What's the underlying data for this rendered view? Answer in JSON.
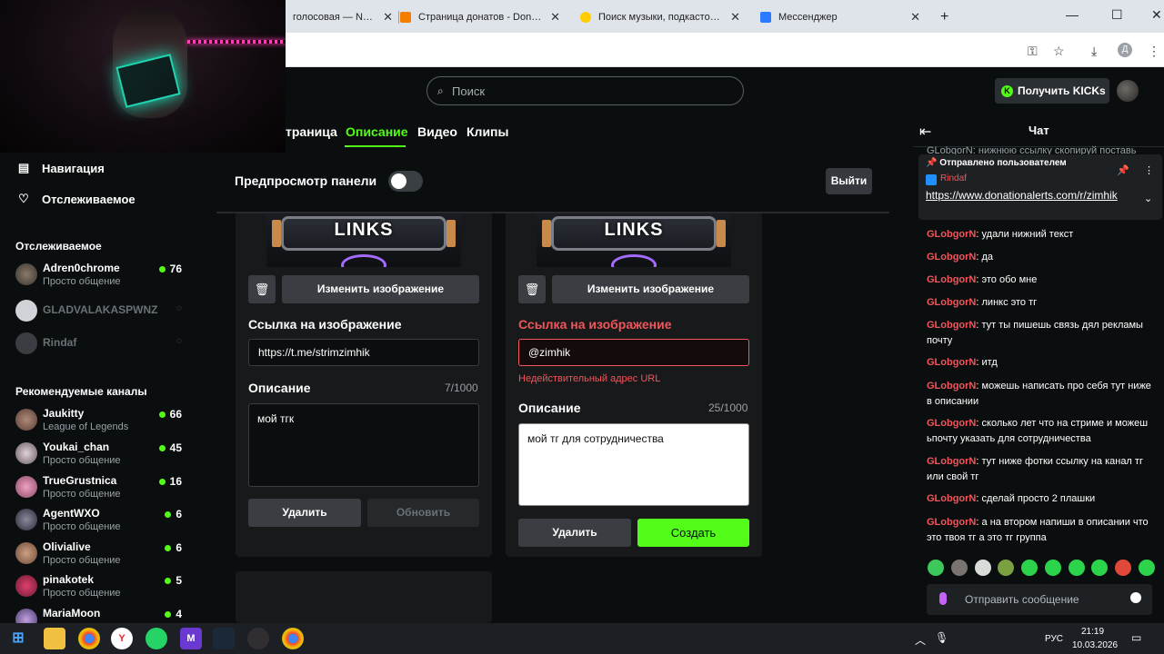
{
  "browser": {
    "tabs": [
      {
        "label": "голосовая — Nekt"
      },
      {
        "label": "Страница донатов - DonationA"
      },
      {
        "label": "Поиск музыки, подкастов и ау"
      },
      {
        "label": "Мессенджер"
      }
    ],
    "new_tab": "+",
    "profile_letter": "Д"
  },
  "header": {
    "search_placeholder": "Поиск",
    "kicks_button": "Получить KICKs"
  },
  "nav": {
    "main": [
      {
        "label": "Навигация"
      },
      {
        "label": "Отслеживаемое"
      }
    ],
    "following_heading": "Отслеживаемое",
    "following": [
      {
        "name": "Adren0chrome",
        "category": "Просто общение",
        "viewers": "76"
      },
      {
        "name": "GLADVALAKASPWNZ"
      },
      {
        "name": "Rindaf"
      }
    ],
    "recommended_heading": "Рекомендуемые каналы",
    "recommended": [
      {
        "name": "Jaukitty",
        "category": "League of Legends",
        "viewers": "66"
      },
      {
        "name": "Youkai_chan",
        "category": "Просто общение",
        "viewers": "45"
      },
      {
        "name": "TrueGrustnica",
        "category": "Просто общение",
        "viewers": "16"
      },
      {
        "name": "AgentWXO",
        "category": "Просто общение",
        "viewers": "6"
      },
      {
        "name": "Olivialive",
        "category": "Просто общение",
        "viewers": "6"
      },
      {
        "name": "pinakotek",
        "category": "Просто общение",
        "viewers": "5"
      },
      {
        "name": "MariaMoon",
        "viewers": "4"
      }
    ]
  },
  "settings": {
    "tabs": [
      {
        "label": "траница"
      },
      {
        "label": "Описание"
      },
      {
        "label": "Видео"
      },
      {
        "label": "Клипы"
      }
    ],
    "preview_label": "Предпросмотр панели",
    "exit_button": "Выйти",
    "panel_left": {
      "image_text": "LINKS",
      "change_image": "Изменить изображение",
      "link_label": "Ссылка на изображение",
      "link_value": "https://t.me/strimzimhik",
      "desc_label": "Описание",
      "desc_counter": "7/1000",
      "desc_value": "мой тгк",
      "delete_button": "Удалить",
      "update_button": "Обновить"
    },
    "panel_right": {
      "image_text": "LINKS",
      "change_image": "Изменить изображение",
      "link_label": "Ссылка на изображение",
      "link_value": "@zimhik",
      "link_error": "Недействительный адрес URL",
      "desc_label": "Описание",
      "desc_counter": "25/1000",
      "desc_value": "мой тг для сотрудничества",
      "delete_button": "Удалить",
      "create_button": "Создать"
    }
  },
  "chat": {
    "title": "Чат",
    "cut_message": "GLobgorN: нижнюю ссылку скопируй поставь",
    "pinned": {
      "header": "Отправлено пользователем",
      "user": "Rindaf",
      "link": "https://www.donationalerts.com/r/zimhik"
    },
    "messages": [
      {
        "user": "GLobgorN",
        "text": "удали нижний текст"
      },
      {
        "user": "GLobgorN",
        "text": "да"
      },
      {
        "user": "GLobgorN",
        "text": "это обо мне"
      },
      {
        "user": "GLobgorN",
        "text": "линкс это тг"
      },
      {
        "user": "GLobgorN",
        "text": "тут ты пишешь связь дял рекламы почту"
      },
      {
        "user": "GLobgorN",
        "text": "итд"
      },
      {
        "user": "GLobgorN",
        "text": "можешь написать про себя тут ниже в описании"
      },
      {
        "user": "GLobgorN",
        "text": "сколько лет что на стриме и можеш ьпочту указать для сотрудничества"
      },
      {
        "user": "GLobgorN",
        "text": "тут ниже фотки ссылку на канал тг или свой тг"
      },
      {
        "user": "GLobgorN",
        "text": "сделай просто 2 плашки"
      },
      {
        "user": "GLobgorN",
        "text": "а на втором напиши в описании что это твоя тг а это тг группа"
      }
    ],
    "input_placeholder": "Отправить сообщение"
  },
  "taskbar": {
    "time": "21:19",
    "date": "10.03.2026",
    "lang": "РУС"
  },
  "colors": {
    "kick_green": "#53fc18",
    "error_red": "#f0565b",
    "username_red": "#f0565b"
  }
}
